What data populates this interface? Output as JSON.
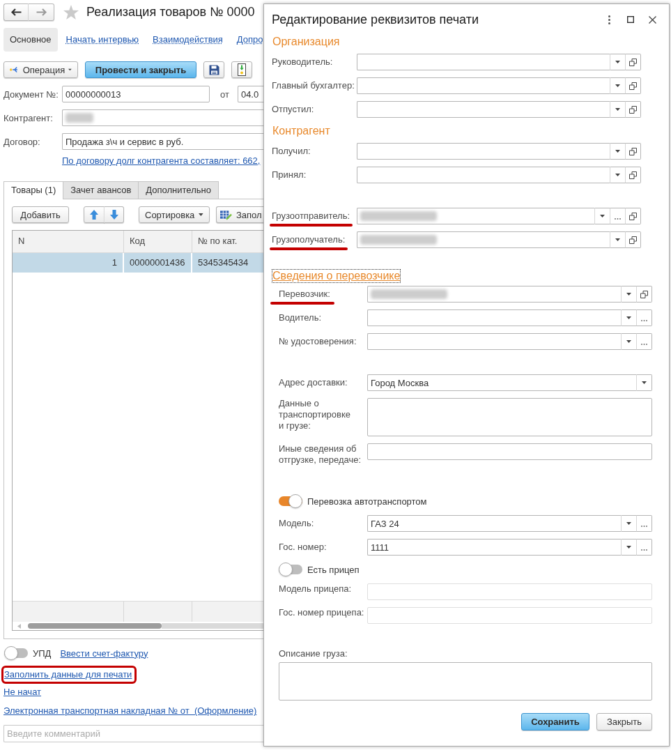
{
  "main_form": {
    "title": "Реализация товаров № 0000",
    "favorite": false,
    "nav_tabs": [
      {
        "label": "Основное",
        "selected": true
      },
      {
        "label": "Начать интервью",
        "selected": false
      },
      {
        "label": "Взаимодействия",
        "selected": false
      },
      {
        "label": "Допро",
        "selected": false
      }
    ],
    "toolbar": [
      {
        "kind": "menu",
        "label": "Операция"
      },
      {
        "kind": "primary",
        "label": "Провести и закрыть"
      },
      {
        "kind": "save"
      },
      {
        "kind": "structure"
      }
    ],
    "document_number": {
      "label": "Документ №:",
      "value": "00000000013"
    },
    "date": {
      "label": "от",
      "value": "04.0"
    },
    "counterparty": {
      "label": "Контрагент:",
      "redacted": true
    },
    "contract": {
      "label": "Договор:",
      "value": "Продажа з\\ч и сервис в руб."
    },
    "debt_link": "По договору долг контрагента составляет: 662,",
    "tabs": [
      {
        "label": "Товары (1)",
        "selected": true
      },
      {
        "label": "Зачет авансов",
        "selected": false
      },
      {
        "label": "Дополнительно",
        "selected": false
      }
    ],
    "table_toolbar": [
      {
        "kind": "button",
        "label": "Добавить"
      },
      {
        "kind": "move"
      },
      {
        "kind": "menu",
        "label": "Сортировка"
      },
      {
        "kind": "fill",
        "label": "Запол"
      }
    ],
    "table": {
      "columns": [
        "N",
        "Код",
        "№ по кат."
      ],
      "rows": [
        {
          "selected": true,
          "cells": [
            "1",
            "00000001436",
            "5345345434"
          ]
        }
      ]
    },
    "upd": {
      "label": "УПД",
      "on": false
    },
    "invoice_link": "Ввести счет-фактуру",
    "links": [
      {
        "label": "Заполнить данные для печати",
        "highlighted": true
      },
      {
        "label": "Не начат",
        "highlighted": false
      },
      {
        "label": "Электронная транспортная накладная № от  (Оформление)",
        "highlighted": false
      }
    ],
    "comment": {
      "placeholder": "Введите комментарий"
    }
  },
  "dialog": {
    "title": "Редактирование реквизитов печати",
    "sections": [
      {
        "kind": "plain",
        "title": "Организация",
        "focused": false,
        "groups": [
          [
            {
              "kind": "select",
              "label": "Руководитель:",
              "buttons": [
                {
                  "kind": "dropdown"
                },
                {
                  "kind": "open"
                }
              ],
              "marked": false,
              "redacted": false,
              "disabled": false
            },
            {
              "kind": "select",
              "label": "Главный бухгалтер:",
              "buttons": [
                {
                  "kind": "dropdown"
                },
                {
                  "kind": "open"
                }
              ],
              "marked": false,
              "redacted": false,
              "disabled": false
            },
            {
              "kind": "select",
              "label": "Отпустил:",
              "buttons": [
                {
                  "kind": "dropdown"
                },
                {
                  "kind": "open"
                }
              ],
              "marked": false,
              "redacted": false,
              "disabled": false
            }
          ]
        ]
      },
      {
        "kind": "plain",
        "title": "Контрагент",
        "focused": false,
        "groups": [
          [
            {
              "kind": "select",
              "label": "Получил:",
              "buttons": [
                {
                  "kind": "dropdown"
                },
                {
                  "kind": "open"
                }
              ],
              "marked": false,
              "redacted": false,
              "disabled": false
            },
            {
              "kind": "select",
              "label": "Принял:",
              "buttons": [
                {
                  "kind": "dropdown"
                },
                {
                  "kind": "open"
                }
              ],
              "marked": false,
              "redacted": false,
              "disabled": false
            }
          ],
          [
            {
              "kind": "select",
              "label": "Грузоотправитель:",
              "buttons": [
                {
                  "kind": "dropdown"
                },
                {
                  "kind": "choose"
                },
                {
                  "kind": "open"
                }
              ],
              "marked": true,
              "redacted": true,
              "disabled": false
            },
            {
              "kind": "select",
              "label": "Грузополучатель:",
              "buttons": [
                {
                  "kind": "dropdown"
                },
                {
                  "kind": "open"
                }
              ],
              "marked": true,
              "redacted": true,
              "disabled": false
            }
          ]
        ]
      },
      {
        "kind": "collapsible",
        "title": "Сведения о перевозчике",
        "focused": true,
        "groups": [
          [
            {
              "kind": "select",
              "label": "Перевозчик:",
              "buttons": [
                {
                  "kind": "dropdown"
                },
                {
                  "kind": "open"
                }
              ],
              "marked": true,
              "redacted": true,
              "disabled": false
            },
            {
              "kind": "select",
              "label": "Водитель:",
              "buttons": [
                {
                  "kind": "dropdown"
                },
                {
                  "kind": "choose"
                }
              ],
              "marked": false,
              "redacted": false,
              "disabled": false
            },
            {
              "kind": "select",
              "label": "№ удостоверения:",
              "buttons": [
                {
                  "kind": "dropdown"
                },
                {
                  "kind": "choose"
                }
              ],
              "marked": false,
              "redacted": false,
              "disabled": false
            }
          ],
          [
            {
              "kind": "select",
              "label": "Адрес доставки:",
              "value": "Город Москва",
              "buttons": [
                {
                  "kind": "dropdown"
                }
              ],
              "marked": false,
              "redacted": false,
              "disabled": false
            },
            {
              "kind": "textarea",
              "label": "Данные о\nтранспортировке\nи грузе:",
              "marked": false,
              "redacted": false,
              "disabled": false
            },
            {
              "kind": "text",
              "label": "Иные сведения об\nотгрузке, передаче:",
              "marked": false,
              "redacted": false,
              "disabled": false
            }
          ],
          [
            {
              "kind": "toggle",
              "label": "Перевозка автотранспортом",
              "on": true
            },
            {
              "kind": "select",
              "label": "Модель:",
              "value": "ГАЗ 24",
              "buttons": [
                {
                  "kind": "dropdown"
                },
                {
                  "kind": "choose"
                }
              ],
              "marked": false,
              "redacted": false,
              "disabled": false
            },
            {
              "kind": "select",
              "label": "Гос. номер:",
              "value": "1111",
              "buttons": [
                {
                  "kind": "dropdown"
                },
                {
                  "kind": "choose"
                }
              ],
              "marked": false,
              "redacted": false,
              "disabled": false
            },
            {
              "kind": "toggle",
              "label": "Есть прицеп",
              "on": false
            },
            {
              "kind": "text",
              "label": "Модель прицепа:",
              "marked": false,
              "redacted": false,
              "disabled": true
            },
            {
              "kind": "text",
              "label": "Гос. номер прицепа:",
              "marked": false,
              "redacted": false,
              "disabled": true
            }
          ],
          [
            {
              "kind": "textarea_above",
              "label": "Описание груза:",
              "marked": false,
              "redacted": false,
              "disabled": false
            }
          ]
        ]
      }
    ],
    "buttons": [
      {
        "kind": "primary",
        "label": "Сохранить"
      },
      {
        "kind": "default",
        "label": "Закрыть"
      }
    ]
  }
}
